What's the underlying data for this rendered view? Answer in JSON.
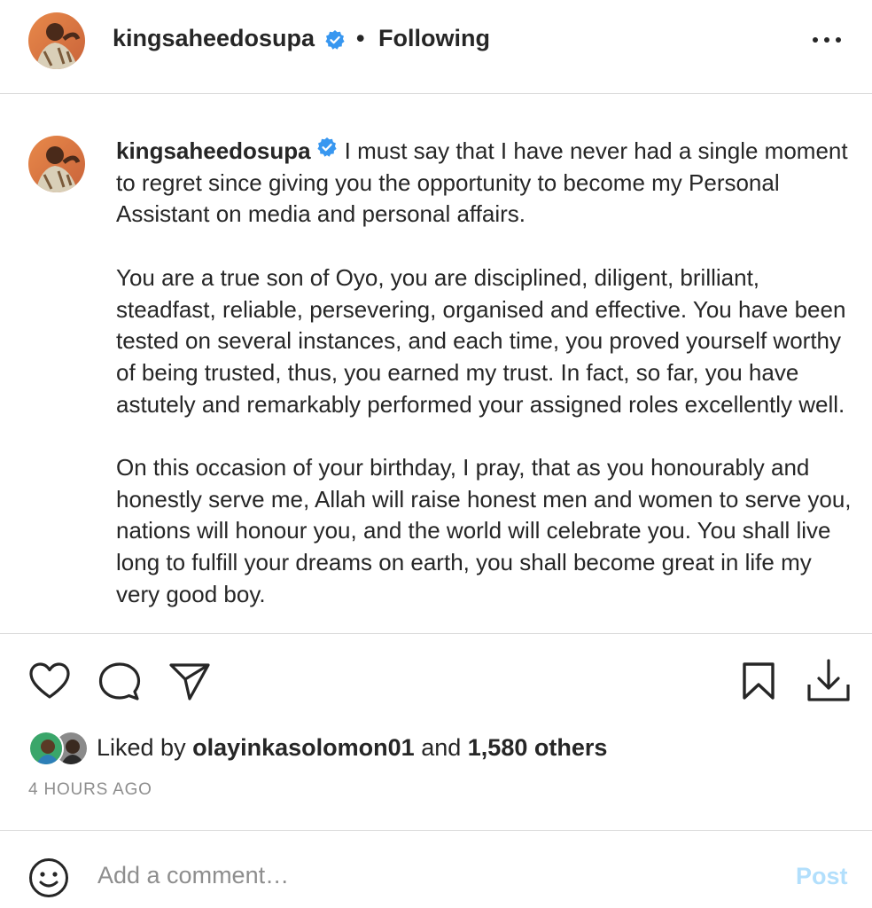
{
  "header": {
    "username": "kingsaheedosupa",
    "separator": "•",
    "follow_status": "Following"
  },
  "caption": {
    "username": "kingsaheedosupa",
    "paragraphs": [
      "I must say that I have never had a single moment to regret since giving you the opportunity to become my Personal Assistant on media and personal affairs.",
      "You are a true son of Oyo, you are disciplined, diligent, brilliant, steadfast, reliable, persevering, organised and effective. You have been tested on several instances, and each time, you proved yourself worthy of being trusted, thus, you earned my trust. In fact, so far, you have astutely and remarkably performed your assigned roles excellently well.",
      "On this occasion of your birthday, I pray, that as you honourably and honestly serve me, Allah will raise honest men and women to serve you, nations will honour you, and the world will celebrate you. You shall live long to fulfill your dreams on earth, you shall become great in life my very good boy."
    ]
  },
  "actions": {
    "like_icon": "heart-icon",
    "comment_icon": "comment-bubble-icon",
    "share_icon": "paper-plane-icon",
    "save_icon": "bookmark-icon",
    "download_icon": "download-icon"
  },
  "likes": {
    "prefix": "Liked by",
    "liker": "olayinkasolomon01",
    "conjunction": "and",
    "others": "1,580 others"
  },
  "timestamp": "4 HOURS AGO",
  "comment": {
    "placeholder": "Add a comment…",
    "post_label": "Post"
  },
  "colors": {
    "verified_blue": "#3897f0",
    "post_disabled": "#b2dffc",
    "muted_text": "#8e8e8e",
    "divider": "#dbdbdb"
  }
}
